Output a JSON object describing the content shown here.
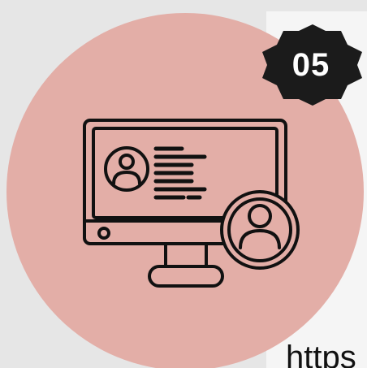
{
  "badge": {
    "number": "05"
  },
  "link": {
    "text": "https"
  },
  "colors": {
    "circle": "#e3aea7",
    "badge": "#1b1b1b",
    "line_art": "#111111",
    "background": "#e6e6e6",
    "card": "#f5f5f5"
  },
  "icons": {
    "illustration": "monitor-with-user-profile-icon",
    "badge": "star-burst-badge-icon"
  }
}
